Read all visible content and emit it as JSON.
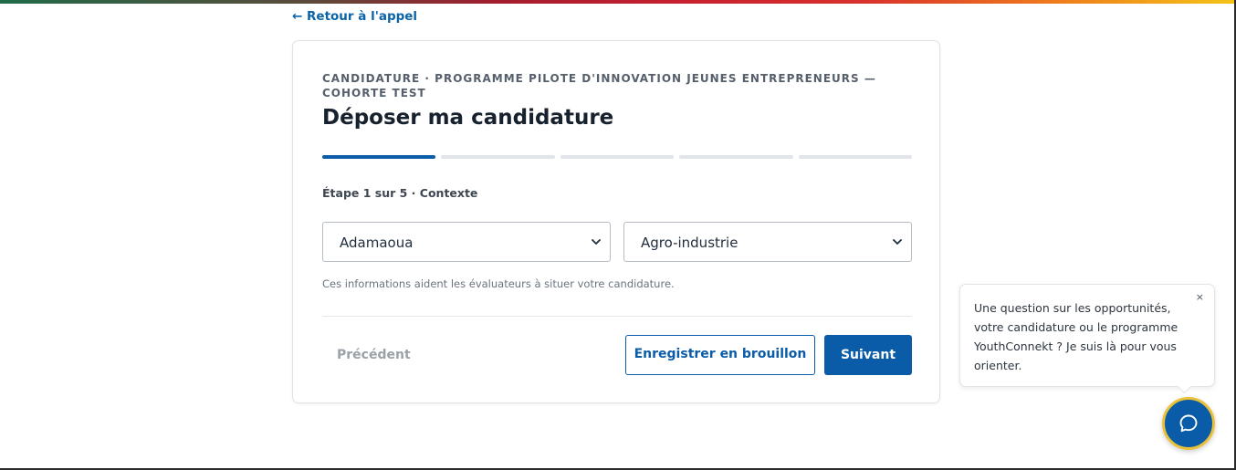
{
  "colors": {
    "accent": "#0b5ca8",
    "fab_ring": "#e9c23a"
  },
  "back_link": {
    "label": "← Retour à l'appel"
  },
  "card": {
    "eyebrow": "CANDIDATURE · PROGRAMME PILOTE D'INNOVATION JEUNES ENTREPRENEURS — COHORTE TEST",
    "title": "Déposer ma candidature",
    "progress": {
      "current_step": 1,
      "total_steps": 5
    },
    "step_label": "Étape 1 sur 5 · Contexte",
    "region_select": {
      "value": "Adamaoua"
    },
    "sector_select": {
      "value": "Agro-industrie"
    },
    "helper_text": "Ces informations aident les évaluateurs à situer votre candidature.",
    "buttons": {
      "previous": "Précédent",
      "save_draft": "Enregistrer en brouillon",
      "next": "Suivant"
    }
  },
  "chat": {
    "message": "Une question sur les opportunités, votre candidature ou le programme YouthConnekt ? Je suis là pour vous orienter.",
    "close_label": "×",
    "fab_icon": "chat-bubble-icon"
  }
}
